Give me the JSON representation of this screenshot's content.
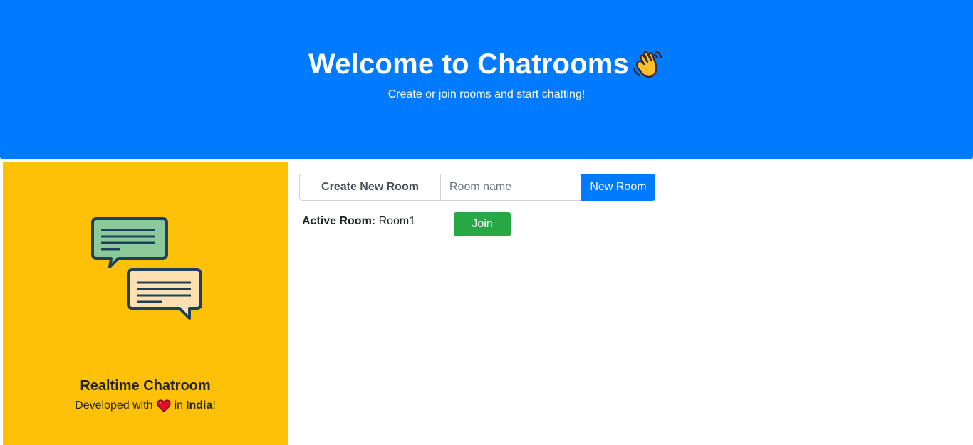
{
  "hero": {
    "title": "Welcome to Chatrooms",
    "title_icon": "waving-hand-icon",
    "subtitle": "Create or join rooms and start chatting!",
    "background_color": "#007bff"
  },
  "side_card": {
    "illustration": "chat-bubbles-icon",
    "title": "Realtime Chatroom",
    "credit_prefix": "Developed with",
    "credit_icon": "heart-icon",
    "credit_middle": "in",
    "credit_country": "India",
    "credit_suffix": "!",
    "background_color": "#ffc107"
  },
  "create_room": {
    "label": "Create New Room",
    "input_placeholder": "Room name",
    "input_value": "",
    "button_label": "New Room"
  },
  "rooms": [
    {
      "key_label": "Active Room:",
      "name": "Room1",
      "button_label": "Join"
    }
  ],
  "colors": {
    "primary": "#007bff",
    "warning": "#ffc107",
    "success": "#28a745"
  }
}
